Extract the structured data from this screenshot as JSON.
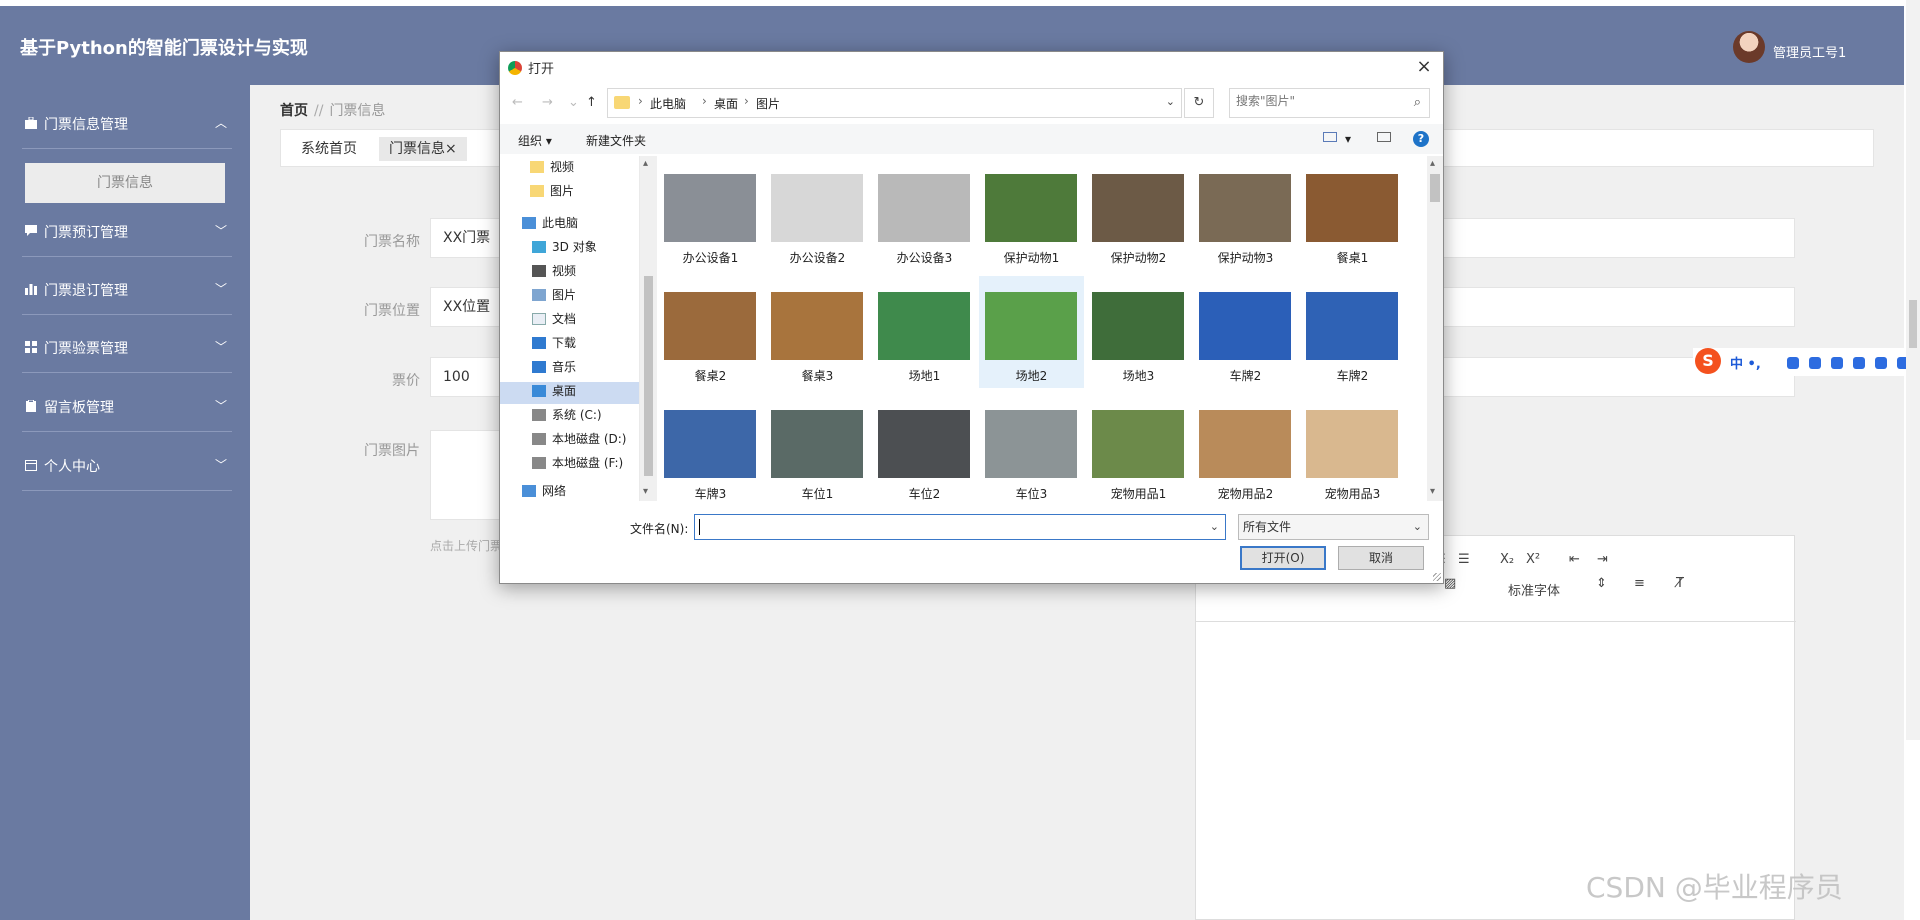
{
  "app": {
    "title": "基于Python的智能门票设计与实现",
    "user_name": "管理员工号1"
  },
  "sidebar": {
    "items": [
      {
        "label": "门票信息管理",
        "icon": "briefcase-icon",
        "expanded": true
      },
      {
        "label": "门票预订管理",
        "icon": "chat-icon",
        "expanded": false
      },
      {
        "label": "门票退订管理",
        "icon": "bar-chart-icon",
        "expanded": false
      },
      {
        "label": "门票验票管理",
        "icon": "grid-icon",
        "expanded": false
      },
      {
        "label": "留言板管理",
        "icon": "clipboard-icon",
        "expanded": false
      },
      {
        "label": "个人中心",
        "icon": "calendar-icon",
        "expanded": false
      }
    ],
    "submenu": {
      "label": "门票信息"
    }
  },
  "breadcrumb": {
    "home": "首页",
    "separator": "//",
    "current": "门票信息"
  },
  "tabs": [
    {
      "label": "系统首页"
    },
    {
      "label": "门票信息",
      "close": "×"
    }
  ],
  "form": {
    "name": {
      "label": "门票名称",
      "value": "XX门票"
    },
    "location": {
      "label": "门票位置",
      "value": "XX位置"
    },
    "price": {
      "label": "票价",
      "value": "100"
    },
    "image": {
      "label": "门票图片",
      "hint": "点击上传门票"
    }
  },
  "editor": {
    "toolbar_font": "标准字体",
    "subscript": "X₂",
    "superscript": "X²"
  },
  "dialog": {
    "title": "打开",
    "close": "×",
    "path": [
      "此电脑",
      "桌面",
      "图片"
    ],
    "search_placeholder": "搜索\"图片\"",
    "organize": "组织 ▾",
    "new_folder": "新建文件夹",
    "tree": [
      {
        "label": "视频",
        "icon": "folder-icon"
      },
      {
        "label": "图片",
        "icon": "folder-icon"
      },
      {
        "label": "此电脑",
        "icon": "computer-icon"
      },
      {
        "label": "3D 对象",
        "icon": "cube-icon"
      },
      {
        "label": "视频",
        "icon": "video-icon"
      },
      {
        "label": "图片",
        "icon": "picture-icon"
      },
      {
        "label": "文档",
        "icon": "document-icon"
      },
      {
        "label": "下载",
        "icon": "download-icon"
      },
      {
        "label": "音乐",
        "icon": "music-icon"
      },
      {
        "label": "桌面",
        "icon": "desktop-icon",
        "selected": true
      },
      {
        "label": "系统 (C:)",
        "icon": "drive-icon"
      },
      {
        "label": "本地磁盘 (D:)",
        "icon": "drive-icon"
      },
      {
        "label": "本地磁盘 (F:)",
        "icon": "drive-icon"
      },
      {
        "label": "网络",
        "icon": "network-icon"
      }
    ],
    "files": [
      {
        "name": "办公设备1",
        "color": "#8a8f96"
      },
      {
        "name": "办公设备2",
        "color": "#d7d7d7"
      },
      {
        "name": "办公设备3",
        "color": "#b9b9b9"
      },
      {
        "name": "保护动物1",
        "color": "#4e7a3a"
      },
      {
        "name": "保护动物2",
        "color": "#6c5a46"
      },
      {
        "name": "保护动物3",
        "color": "#7a6a55"
      },
      {
        "name": "餐桌1",
        "color": "#8a5a32"
      },
      {
        "name": "餐桌2",
        "color": "#9b6a3c"
      },
      {
        "name": "餐桌3",
        "color": "#a8743d"
      },
      {
        "name": "场地1",
        "color": "#3f8a4c"
      },
      {
        "name": "场地2",
        "color": "#5aa04a"
      },
      {
        "name": "场地3",
        "color": "#3f6d3a"
      },
      {
        "name": "车牌2",
        "color": "#2b5fb8"
      },
      {
        "name": "车牌2",
        "color": "#2f62b5"
      },
      {
        "name": "车牌3",
        "color": "#3d67a8"
      },
      {
        "name": "车位1",
        "color": "#5a6a66"
      },
      {
        "name": "车位2",
        "color": "#4c4f52"
      },
      {
        "name": "车位3",
        "color": "#8c9496"
      },
      {
        "name": "宠物用品1",
        "color": "#6c8a4a"
      },
      {
        "name": "宠物用品2",
        "color": "#b98b5a"
      },
      {
        "name": "宠物用品3",
        "color": "#d9b88f"
      }
    ],
    "filename_label": "文件名(N):",
    "filename_value": "",
    "filetype": "所有文件",
    "open_button": "打开(O)",
    "cancel_button": "取消"
  },
  "ime": {
    "label": "中 •,"
  },
  "watermark": "CSDN @毕业程序员",
  "colors": {
    "sidebar": "#6a7aa1",
    "accent": "#3a78c8"
  }
}
